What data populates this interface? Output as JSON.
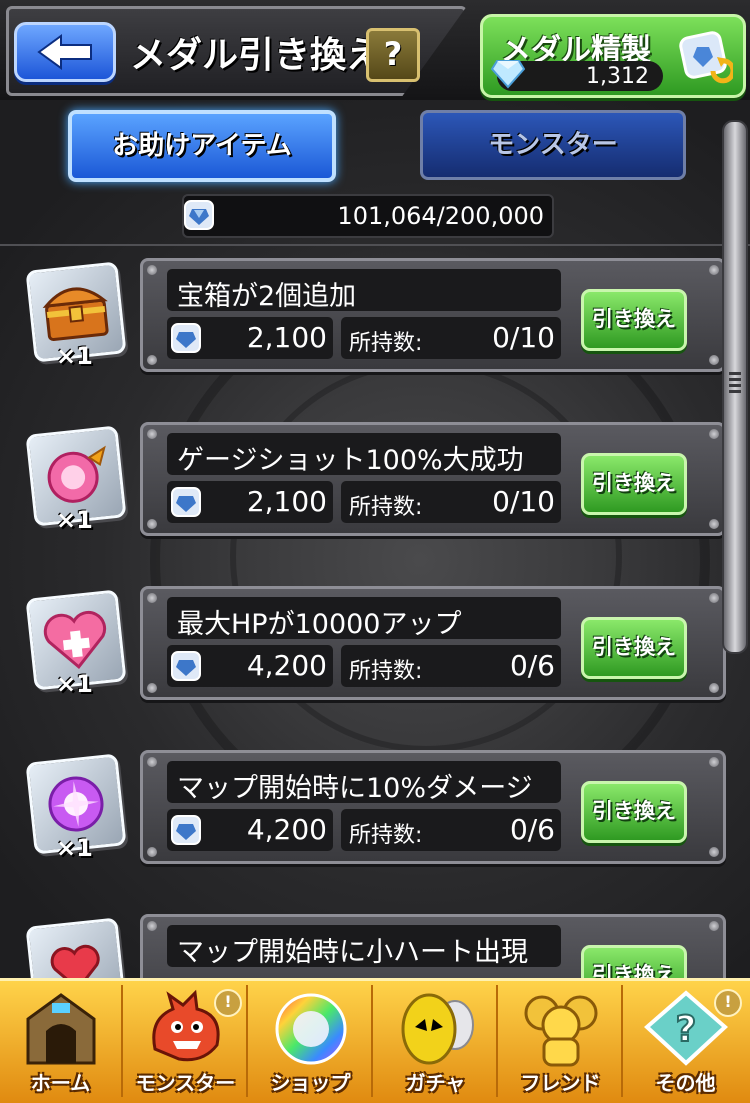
{
  "header": {
    "title": "メダル引き換え",
    "help_label": "?",
    "refine_label": "メダル精製",
    "refine_count": "1,312"
  },
  "tabs": [
    {
      "label": "お助けアイテム",
      "active": true
    },
    {
      "label": "モンスター",
      "active": false
    }
  ],
  "medal_total": "101,064/200,000",
  "colors": {
    "accent_blue": "#1b58d6",
    "accent_green": "#2f9a22",
    "nav_orange": "#e08a10"
  },
  "items": [
    {
      "name": "宝箱が2個追加",
      "qty": "×1",
      "cost": "2,100",
      "owned_label": "所持数:",
      "owned": "0/10",
      "button": "引き換え",
      "icon": "treasure-chest-icon"
    },
    {
      "name": "ゲージショット100%大成功",
      "qty": "×1",
      "cost": "2,100",
      "owned_label": "所持数:",
      "owned": "0/10",
      "button": "引き換え",
      "icon": "gauge-orb-icon"
    },
    {
      "name": "最大HPが10000アップ",
      "qty": "×1",
      "cost": "4,200",
      "owned_label": "所持数:",
      "owned": "0/6",
      "button": "引き換え",
      "icon": "heart-plus-icon"
    },
    {
      "name": "マップ開始時に10%ダメージ",
      "qty": "×1",
      "cost": "4,200",
      "owned_label": "所持数:",
      "owned": "0/6",
      "button": "引き換え",
      "icon": "energy-orb-icon"
    },
    {
      "name": "マップ開始時に小ハート出現",
      "button": "引き換え",
      "icon": "small-heart-icon"
    }
  ],
  "nav": [
    {
      "label": "ホーム",
      "icon": "home-gate-icon",
      "alert": false
    },
    {
      "label": "モンスター",
      "icon": "dragon-icon",
      "alert": true
    },
    {
      "label": "ショップ",
      "icon": "rainbow-orb-icon",
      "alert": false
    },
    {
      "label": "ガチャ",
      "icon": "egg-icon",
      "alert": false
    },
    {
      "label": "フレンド",
      "icon": "friends-icon",
      "alert": false
    },
    {
      "label": "その他",
      "icon": "other-menu-icon",
      "alert": true
    }
  ],
  "alert_mark": "!"
}
